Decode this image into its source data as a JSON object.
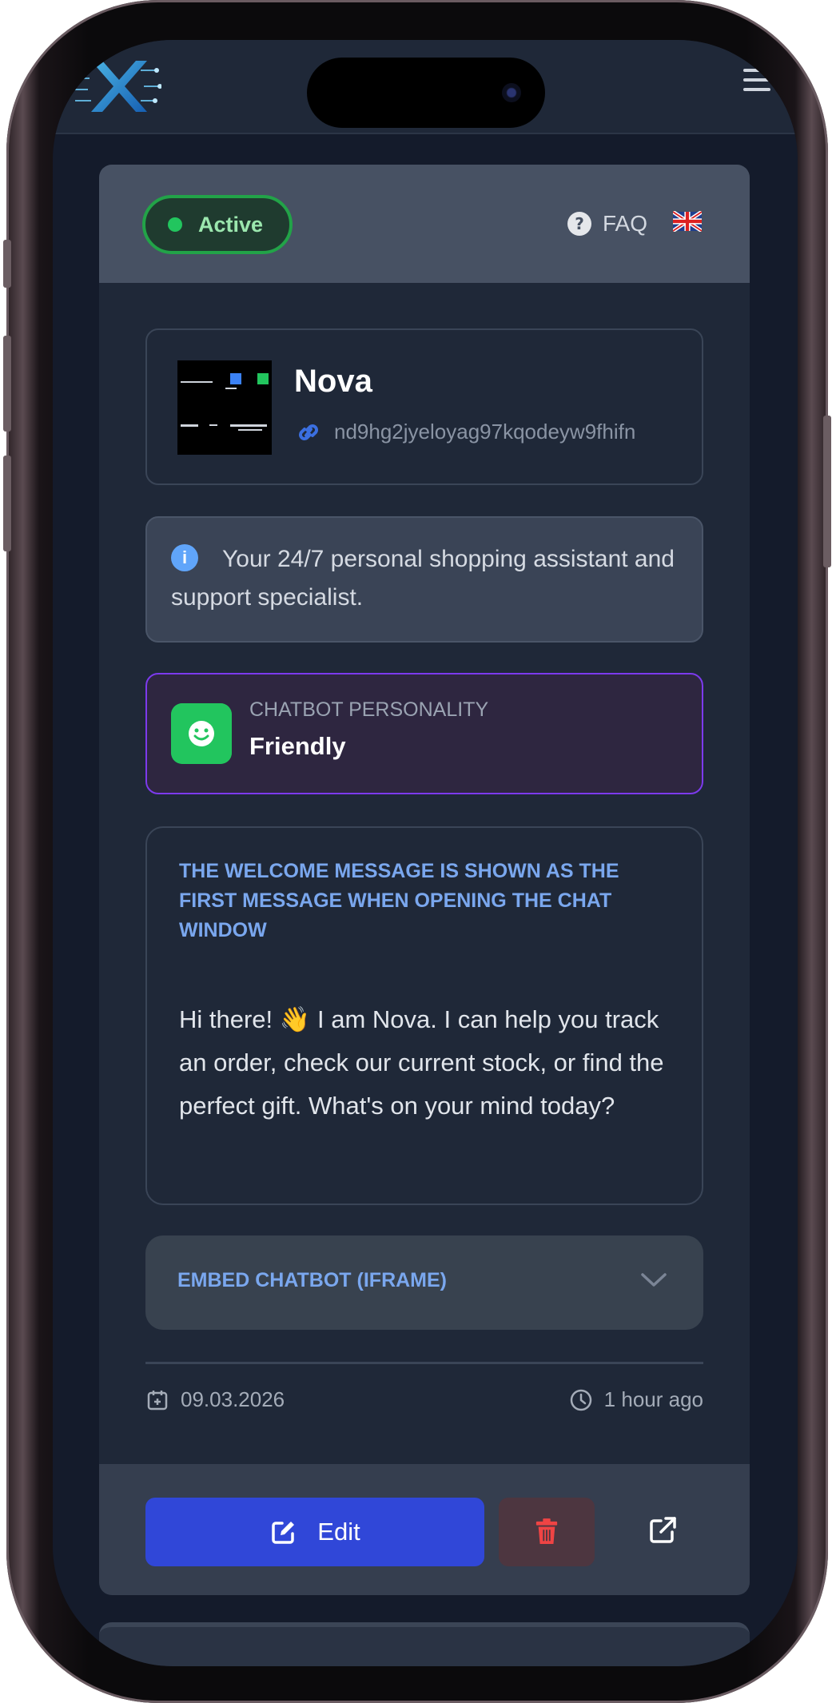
{
  "header": {
    "logo_name": "x-logo",
    "menu_icon": "hamburger-icon"
  },
  "card": {
    "status": "Active",
    "faq_label": "FAQ",
    "language_flag": "uk-flag-icon",
    "bot_name": "Nova",
    "bot_id": "nd9hg2jyeloyag97kqodeyw9fhifn",
    "description": "Your 24/7 personal shopping assistant and support specialist.",
    "personality_label": "CHATBOT PERSONALITY",
    "personality_value": "Friendly",
    "welcome_title": "THE WELCOME MESSAGE IS SHOWN AS THE FIRST MESSAGE WHEN OPENING THE CHAT WINDOW",
    "welcome_message": "Hi there! 👋 I am Nova. I can help you track an order, check our current stock, or find the perfect gift. What's on your mind today?",
    "embed_label": "EMBED CHATBOT (IFRAME)",
    "created_date": "09.03.2026",
    "updated_relative": "1 hour ago",
    "edit_label": "Edit"
  },
  "colors": {
    "accent": "#3047d8",
    "active": "#22c55e",
    "personality_border": "#7c3aed",
    "delete": "#ef4444"
  }
}
